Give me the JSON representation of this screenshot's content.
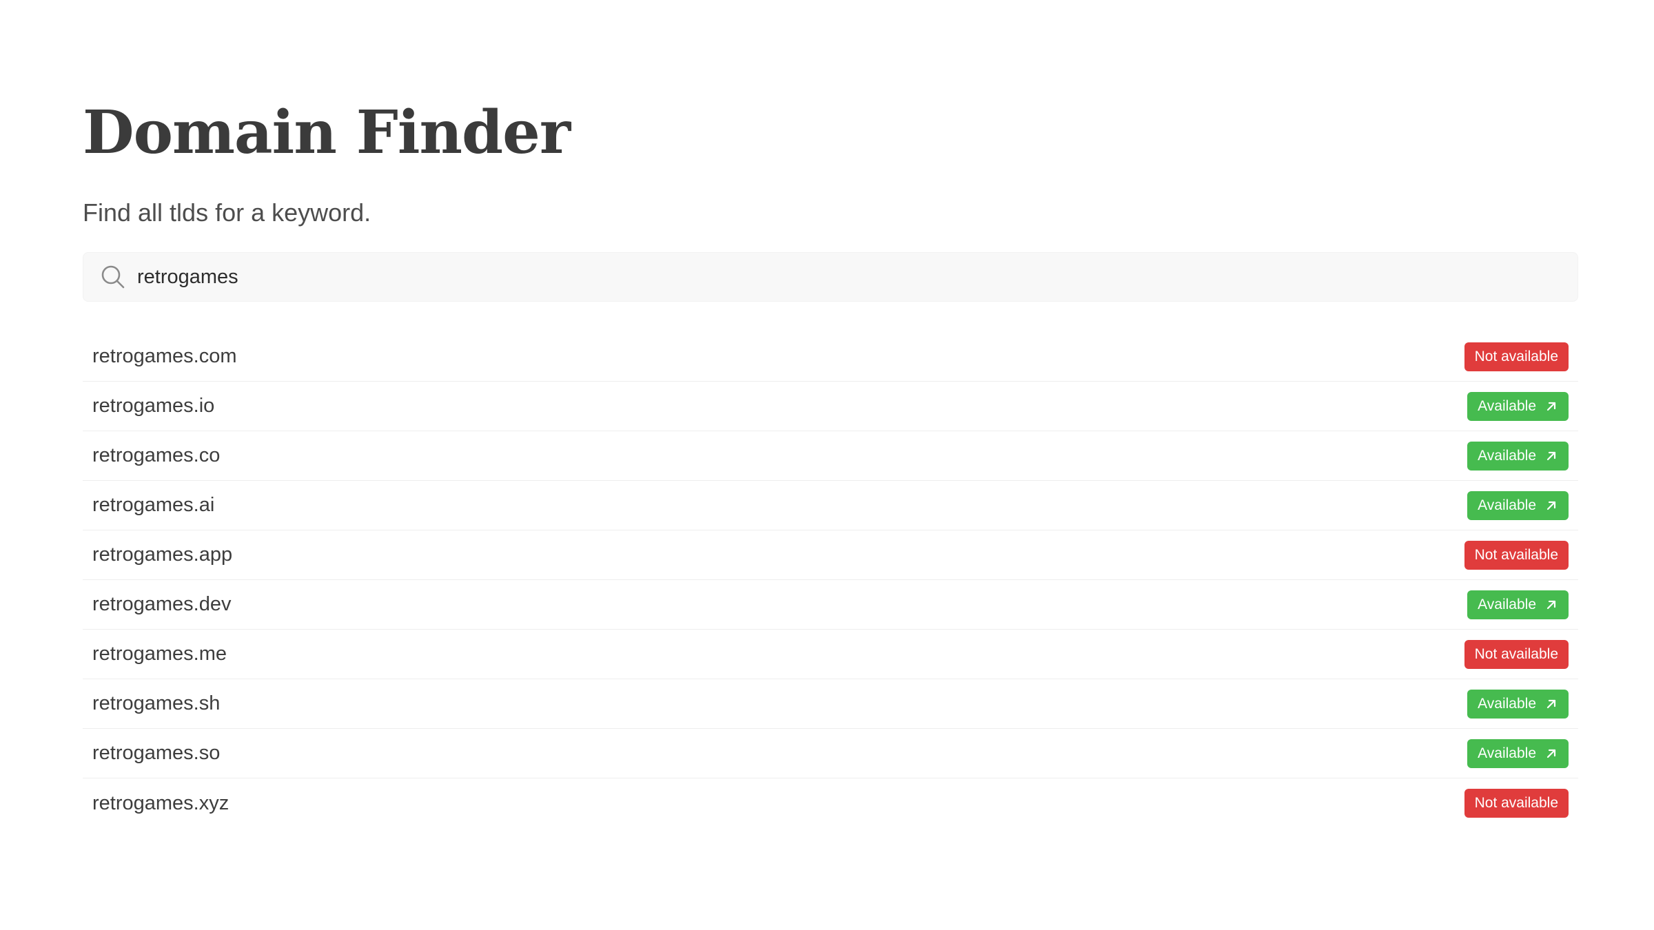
{
  "page": {
    "title": "Domain Finder",
    "subtitle": "Find all tlds for a keyword."
  },
  "search": {
    "value": "retrogames",
    "icon": "search-icon"
  },
  "colors": {
    "not_available": "#e03c3c",
    "available": "#46bb4f",
    "search_bg": "#f8f8f8"
  },
  "results": [
    {
      "domain": "retrogames.com",
      "status": "Not available",
      "available": false
    },
    {
      "domain": "retrogames.io",
      "status": "Available",
      "available": true
    },
    {
      "domain": "retrogames.co",
      "status": "Available",
      "available": true
    },
    {
      "domain": "retrogames.ai",
      "status": "Available",
      "available": true
    },
    {
      "domain": "retrogames.app",
      "status": "Not available",
      "available": false
    },
    {
      "domain": "retrogames.dev",
      "status": "Available",
      "available": true
    },
    {
      "domain": "retrogames.me",
      "status": "Not available",
      "available": false
    },
    {
      "domain": "retrogames.sh",
      "status": "Available",
      "available": true
    },
    {
      "domain": "retrogames.so",
      "status": "Available",
      "available": true
    },
    {
      "domain": "retrogames.xyz",
      "status": "Not available",
      "available": false
    }
  ]
}
